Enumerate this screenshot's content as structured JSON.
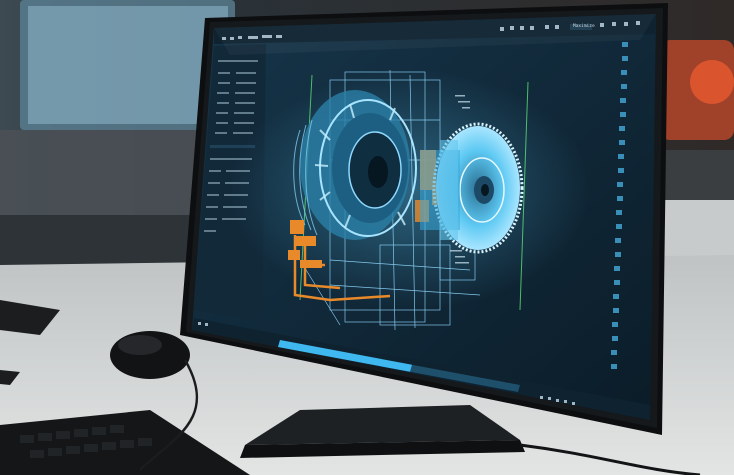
{
  "scene": {
    "description_kind": "photo",
    "monitor": {
      "app": {
        "toolbar": {
          "right_button_label": "Maximize",
          "icons": [
            "grid-icon",
            "layers-icon",
            "cube-icon",
            "settings-icon"
          ]
        },
        "left_panel": {
          "rows": 16
        },
        "viewport": {
          "model": "turbine-engine-wireframe",
          "highlight_color": "#e8892a",
          "wire_color": "#6fd3ff"
        },
        "right_toolbar": {
          "icon_count": 24
        },
        "status_bar": {
          "progress": 0.55
        }
      }
    },
    "colors": {
      "screen_bg": "#0f2433",
      "panel_bg": "#142b3a",
      "accent_cyan": "#3fb8ef",
      "orange": "#e8892a",
      "desk": "#cfd2d2",
      "bezel": "#101214"
    }
  }
}
